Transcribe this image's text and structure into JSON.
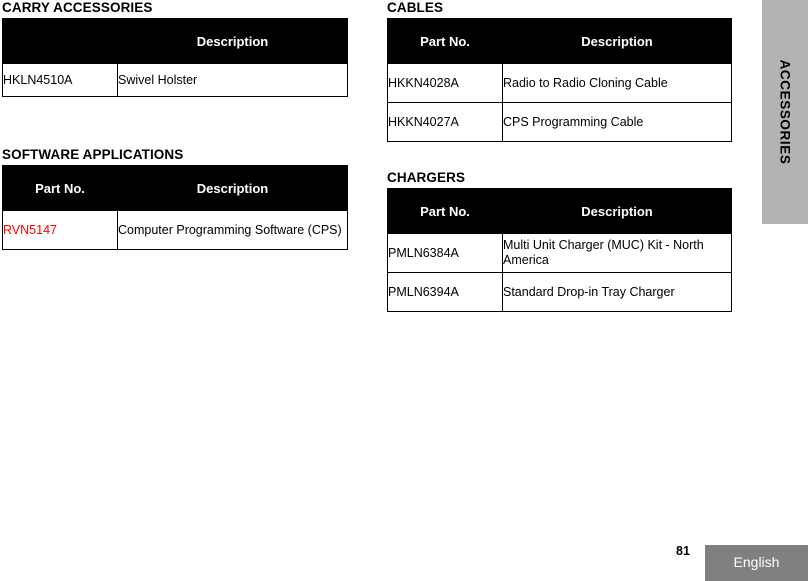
{
  "page": {
    "number": "81",
    "language": "English",
    "side_tab": "ACCESSORIES"
  },
  "colors": {
    "header_bg": "#000000",
    "header_text": "#ffffff",
    "highlight_part": "#ff0000",
    "side_tab_bg": "#b3b3b3",
    "footer_lang_bg": "#808080"
  },
  "sections": {
    "carry": {
      "title": "CARRY ACCESSORIES",
      "columns": [
        "",
        "Description"
      ],
      "rows": [
        {
          "part": "HKLN4510A",
          "description": "Swivel Holster"
        }
      ]
    },
    "software": {
      "title": "SOFTWARE APPLICATIONS",
      "columns": [
        "Part No.",
        "Description"
      ],
      "rows": [
        {
          "part": "RVN5147",
          "description": "Computer Programming Software (CPS)",
          "part_color": "#ff0000"
        }
      ]
    },
    "cables": {
      "title": "CABLES",
      "columns": [
        "Part No.",
        "Description"
      ],
      "rows": [
        {
          "part": "HKKN4028A",
          "description": "Radio to Radio Cloning Cable"
        },
        {
          "part": "HKKN4027A",
          "description": "CPS Programming Cable"
        }
      ]
    },
    "chargers": {
      "title": "CHARGERS",
      "columns": [
        "Part No.",
        "Description"
      ],
      "rows": [
        {
          "part": "PMLN6384A",
          "description": "Multi Unit Charger (MUC) Kit - North America"
        },
        {
          "part": "PMLN6394A",
          "description": "Standard Drop-in Tray Charger"
        }
      ]
    }
  }
}
